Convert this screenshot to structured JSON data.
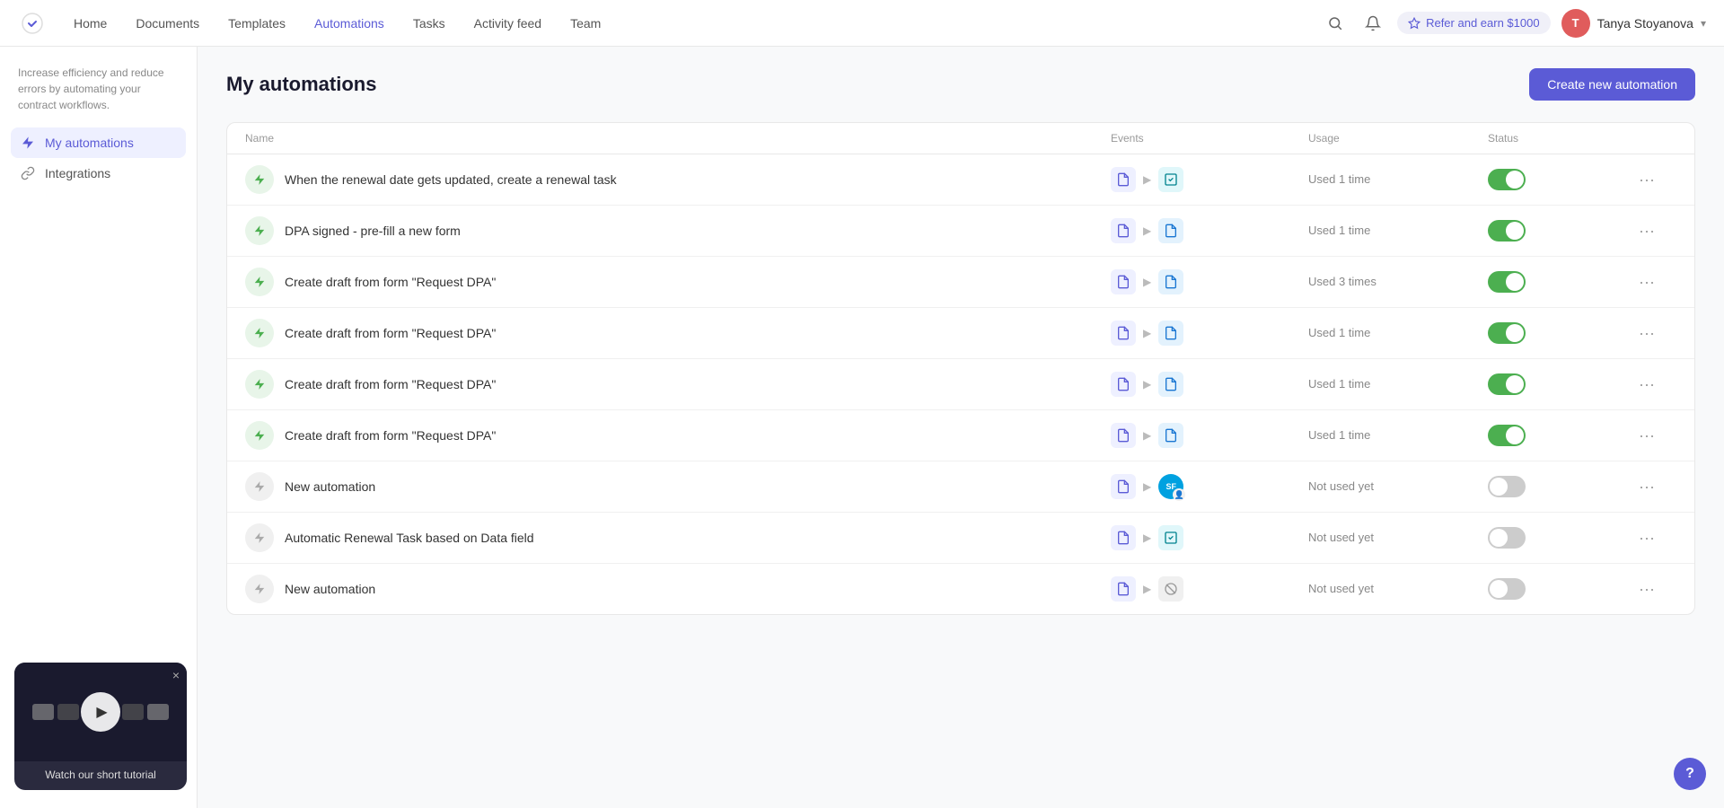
{
  "nav": {
    "links": [
      {
        "label": "Home",
        "active": false,
        "name": "home"
      },
      {
        "label": "Documents",
        "active": false,
        "name": "documents"
      },
      {
        "label": "Templates",
        "active": false,
        "name": "templates"
      },
      {
        "label": "Automations",
        "active": true,
        "name": "automations"
      },
      {
        "label": "Tasks",
        "active": false,
        "name": "tasks"
      },
      {
        "label": "Activity feed",
        "active": false,
        "name": "activity-feed"
      },
      {
        "label": "Team",
        "active": false,
        "name": "team"
      }
    ],
    "refer_label": "Refer and earn $1000",
    "user_name": "Tanya Stoyanova",
    "user_initials": "T"
  },
  "sidebar": {
    "desc": "Increase efficiency and reduce errors by automating your contract workflows.",
    "items": [
      {
        "label": "My automations",
        "active": true,
        "icon": "bolt",
        "name": "my-automations"
      },
      {
        "label": "Integrations",
        "active": false,
        "icon": "link",
        "name": "integrations"
      }
    ]
  },
  "main": {
    "title": "My automations",
    "create_button": "Create new automation",
    "table": {
      "columns": [
        "Name",
        "Events",
        "Usage",
        "Status"
      ],
      "rows": [
        {
          "name": "When the renewal date gets updated, create a renewal task",
          "icon_active": true,
          "event_source": "doc",
          "event_target": "checkbox",
          "event_target_type": "teal",
          "usage": "Used 1 time",
          "status_on": true
        },
        {
          "name": "DPA signed - pre-fill a new form",
          "icon_active": true,
          "event_source": "doc",
          "event_target": "doc-blue",
          "event_target_type": "blue",
          "usage": "Used 1 time",
          "status_on": true
        },
        {
          "name": "Create draft from form \"Request DPA\"",
          "icon_active": true,
          "event_source": "doc",
          "event_target": "doc-blue",
          "event_target_type": "blue",
          "usage": "Used 3 times",
          "status_on": true
        },
        {
          "name": "Create draft from form \"Request DPA\"",
          "icon_active": true,
          "event_source": "doc",
          "event_target": "doc-blue",
          "event_target_type": "blue",
          "usage": "Used 1 time",
          "status_on": true
        },
        {
          "name": "Create draft from form \"Request DPA\"",
          "icon_active": true,
          "event_source": "doc",
          "event_target": "doc-blue",
          "event_target_type": "blue",
          "usage": "Used 1 time",
          "status_on": true
        },
        {
          "name": "Create draft from form \"Request DPA\"",
          "icon_active": true,
          "event_source": "doc",
          "event_target": "doc-blue",
          "event_target_type": "blue",
          "usage": "Used 1 time",
          "status_on": true
        },
        {
          "name": "New automation",
          "icon_active": false,
          "event_source": "doc",
          "event_target": "salesforce",
          "event_target_type": "salesforce",
          "usage": "Not used yet",
          "status_on": false
        },
        {
          "name": "Automatic Renewal Task based on Data field",
          "icon_active": false,
          "event_source": "doc",
          "event_target": "checkbox",
          "event_target_type": "teal",
          "usage": "Not used yet",
          "status_on": false
        },
        {
          "name": "New automation",
          "icon_active": false,
          "event_source": "doc",
          "event_target": "circle-slash",
          "event_target_type": "gray",
          "usage": "Not used yet",
          "status_on": false
        }
      ]
    }
  },
  "tutorial": {
    "label": "Watch our short tutorial",
    "close": "×"
  },
  "help": {
    "label": "?"
  }
}
